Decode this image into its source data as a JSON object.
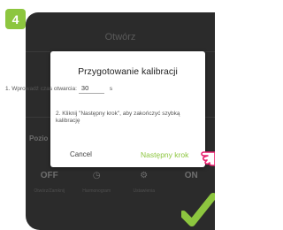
{
  "step_badge": "4",
  "background": {
    "title": "Otwórz",
    "left_label": "Pozio",
    "bottom_items": [
      {
        "icon": "OFF",
        "label": "Otwórz/Zamknij"
      },
      {
        "icon": "◷",
        "label": "Harmonogram"
      },
      {
        "icon": "⚙",
        "label": "Ustawienia"
      },
      {
        "icon": "ON",
        "label": ""
      }
    ]
  },
  "dialog": {
    "title": "Przygotowanie kalibracji",
    "step1_label": "1. Wprowadź czas otwarcia:",
    "time_value": "30",
    "time_unit": "s",
    "step2_text": "2. Kliknij \"Następny krok\", aby zakończyć szybką kalibrację",
    "cancel_label": "Cancel",
    "next_label": "Następny krok"
  },
  "colors": {
    "accent": "#8dc63f",
    "pointer": "#e8226f"
  }
}
